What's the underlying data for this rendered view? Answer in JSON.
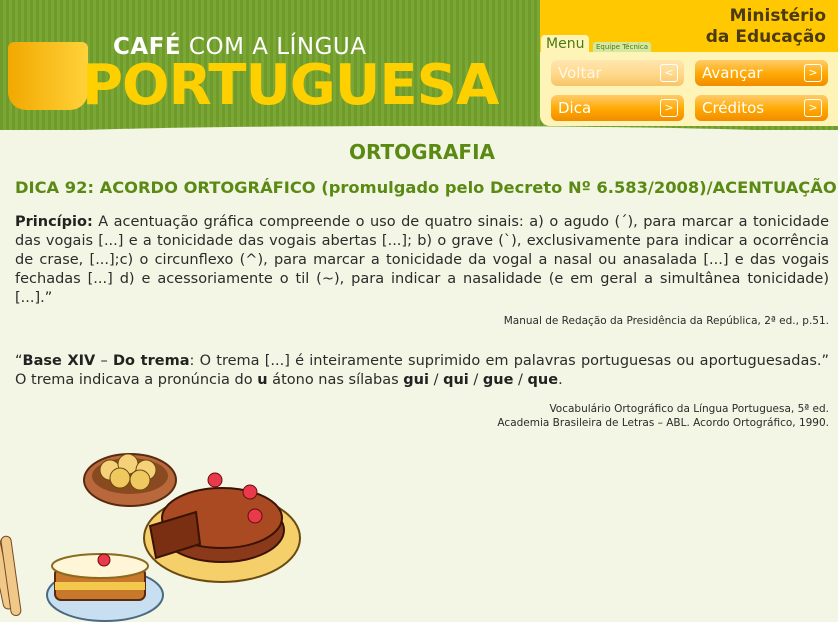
{
  "header": {
    "logo_top_bold": "CAFÉ",
    "logo_top_rest": "COM A LÍNGUA",
    "logo_big": "PORTUGUESA",
    "ministry_line1": "Ministério",
    "ministry_line2": "da Educação",
    "tab_menu": "Menu",
    "tab_equipe": "Equipe Técnica",
    "buttons": {
      "voltar": "Voltar",
      "avancar": "Avançar",
      "dica": "Dica",
      "creditos": "Créditos"
    }
  },
  "main": {
    "title": "ORTOGRAFIA",
    "subtitle": "DICA 92: ACORDO ORTOGRÁFICO (promulgado pelo Decreto Nº 6.583/2008)/ACENTUAÇÃO",
    "principle_label": "Princípio:",
    "principle_text": " A acentuação gráfica compreende o uso de quatro sinais: a) o agudo (´), para marcar a tonicidade das vogais [...] e a tonicidade das vogais abertas [...]; b) o grave (`), exclusivamente para indicar a ocorrência de crase, [...];c) o circunflexo (^), para marcar a tonicidade da vogal a nasal ou anasalada [...] e das vogais fechadas [...] d) e acessoriamente o til (~), para indicar a nasalidade (e em geral a simultânea tonicidade) [...].”",
    "principle_ref": "Manual de Redação da Presidência da República, 2ª ed., p.51.",
    "base_open_quote": "“",
    "base_label": "Base XIV",
    "base_dash": " – ",
    "trema_label": "Do trema",
    "base_text": ": O trema [...] é inteiramente suprimido em palavras portuguesas ou aportuguesadas.” O trema indicava a pronúncia do ",
    "base_u": "u",
    "base_text2": " átono nas sílabas ",
    "syl_gui": "gui",
    "sep1": " / ",
    "syl_qui": "qui",
    "sep2": " / ",
    "syl_gue": "gue",
    "sep3": " / ",
    "syl_que": "que",
    "end_dot": ".",
    "base_ref_line1": "Vocabulário Ortográfico da Língua Portuguesa, 5ª ed.",
    "base_ref_line2": "Academia Brasileira de Letras – ABL. Acordo Ortográfico, 1990."
  },
  "colors": {
    "header_green": "#7aa735",
    "title_green": "#5a8a14",
    "button_orange": "#ffa800",
    "ministry_yellow": "#ffc800"
  }
}
